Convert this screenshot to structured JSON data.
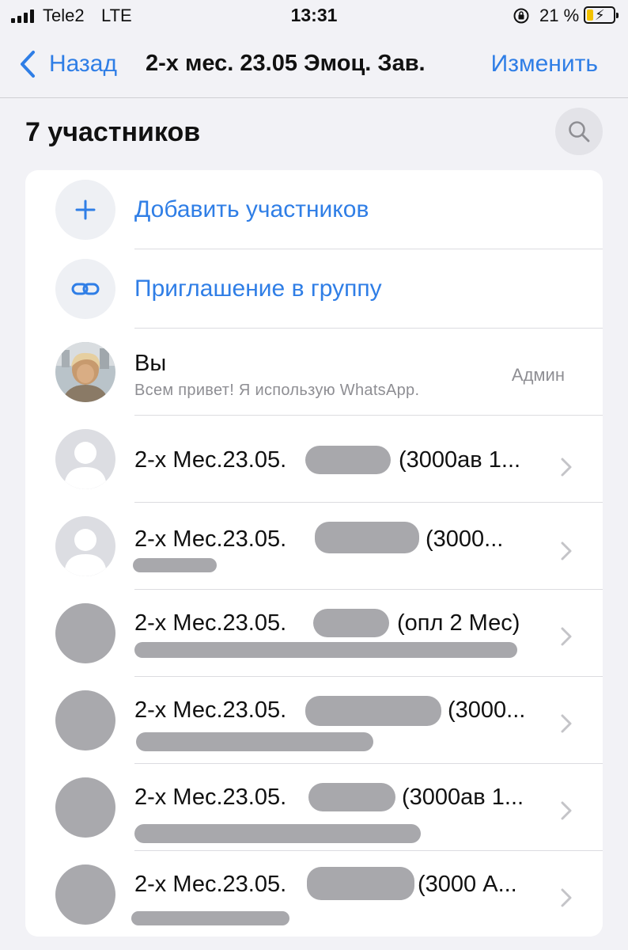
{
  "status": {
    "carrier": "Tele2",
    "network": "LTE",
    "time": "13:31",
    "battery": "21 %"
  },
  "nav": {
    "back_label": "Назад",
    "title": "2-х мес. 23.05 Эмоц. Зав.",
    "edit_label": "Изменить"
  },
  "members": {
    "count_label": "7 участников"
  },
  "actions": [
    {
      "label": "Добавить участников",
      "icon": "plus-icon"
    },
    {
      "label": "Приглашение в группу",
      "icon": "link-icon"
    }
  ],
  "participants": [
    {
      "name": "Вы",
      "status": "Всем привет! Я использую WhatsApp.",
      "role": "Админ"
    },
    {
      "name": "2-х Мес.23.05.",
      "suffix": "(3000ав 1...",
      "status": ""
    },
    {
      "name": "2-х Мес.23.05.",
      "suffix": "(3000...",
      "status": ""
    },
    {
      "name": "2-х Мес.23.05.",
      "suffix": "(опл 2 Мес)",
      "status": ""
    },
    {
      "name": "2-х Мес.23.05.",
      "suffix": "(3000...",
      "status": ""
    },
    {
      "name": "2-х Мес.23.05.",
      "suffix": "(3000ав 1...",
      "status": ""
    },
    {
      "name": "2-х Мес.23.05.",
      "suffix": "(3000 А...",
      "status": ""
    }
  ],
  "colors": {
    "accent": "#2f7ee6",
    "background": "#f2f2f6",
    "secondary_text": "#8e8e93"
  }
}
